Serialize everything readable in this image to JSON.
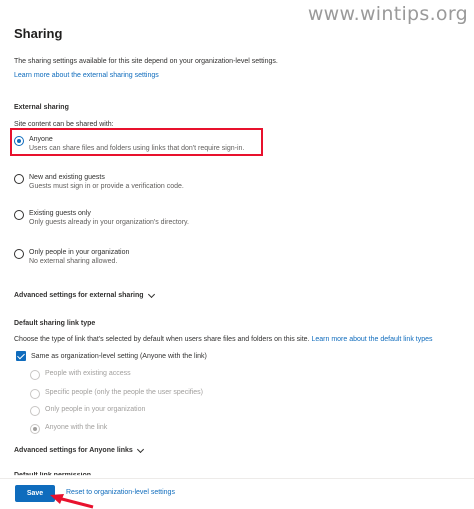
{
  "watermark": "www.wintips.org",
  "page": {
    "title": "Sharing",
    "description": "The sharing settings available for this site depend on your organization-level settings.",
    "learn_more_link": "Learn more about the external sharing settings"
  },
  "external_sharing": {
    "heading": "External sharing",
    "label": "Site content can be shared with:",
    "options": [
      {
        "label": "Anyone",
        "sub": "Users can share files and folders using links that don't require sign-in.",
        "selected": true
      },
      {
        "label": "New and existing guests",
        "sub": "Guests must sign in or provide a verification code.",
        "selected": false
      },
      {
        "label": "Existing guests only",
        "sub": "Only guests already in your organization's directory.",
        "selected": false
      },
      {
        "label": "Only people in your organization",
        "sub": "No external sharing allowed.",
        "selected": false
      }
    ],
    "advanced_label": "Advanced settings for external sharing"
  },
  "default_link": {
    "heading": "Default sharing link type",
    "description_prefix": "Choose the type of link that's selected by default when users share files and folders on this site.",
    "description_link": "Learn more about the default link types",
    "checkbox_label": "Same as organization-level setting (Anyone with the link)",
    "checkbox_checked": true,
    "options": [
      {
        "label": "People with existing access",
        "selected": false
      },
      {
        "label": "Specific people (only the people the user specifies)",
        "selected": false
      },
      {
        "label": "Only people in your organization",
        "selected": false
      },
      {
        "label": "Anyone with the link",
        "selected": true
      }
    ]
  },
  "advanced_anyone_label": "Advanced settings for Anyone links",
  "cut_off_heading": "Default link permission",
  "footer": {
    "save_label": "Save",
    "reset_label": "Reset to organization-level settings"
  },
  "colors": {
    "accent": "#0f6cbd",
    "highlight": "#e8112d"
  }
}
